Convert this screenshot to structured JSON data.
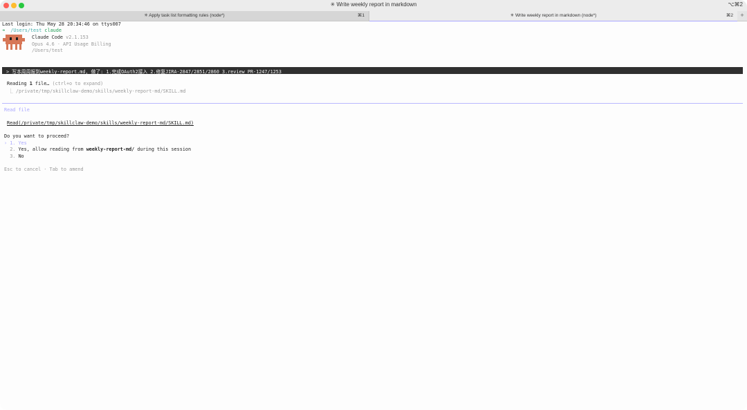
{
  "window": {
    "title": "✳ Write weekly report in markdown",
    "shortcut": "⌥⌘2"
  },
  "tabs": [
    {
      "label": "✳ Apply task list formatting rules (node*)",
      "key": "⌘1"
    },
    {
      "label": "✳ Write weekly report in markdown (node*)",
      "key": "⌘2"
    }
  ],
  "tab_add_label": "+",
  "terminal": {
    "last_login": "Last login: Thu May 28 20:34:46 on ttys007",
    "prompt_arrow": "➜",
    "prompt_path": "/Users/test",
    "prompt_cmd": "claude",
    "app_name": "Claude Code",
    "app_version": "v2.1.153",
    "model_info": "Opus 4.6 · API Usage Billing",
    "cwd": "/Users/test",
    "user_prompt": "> 写本周周报到weekly-report.md, 做了: 1.完成OAuth2接入 2.修复JIRA-2847/2851/2860 3.review PR-1247/1253",
    "reading_label": "Reading ",
    "reading_count": "1",
    "reading_suffix": " file…",
    "reading_hint": "(ctrl+o to expand)",
    "reading_path": "⎿ /private/tmp/skillclaw-demo/skills/weekly-report-md/SKILL.md",
    "section_title": "Read file",
    "read_call": "Read(/private/tmp/skillclaw-demo/skills/weekly-report-md/SKILL.md)",
    "question": "Do you want to proceed?",
    "options": [
      {
        "marker": "›",
        "number": "1.",
        "label": "Yes"
      },
      {
        "number": "2.",
        "prefix": "Yes, allow reading from ",
        "bold": "weekly-report-md/",
        "suffix": " during this session"
      },
      {
        "number": "3.",
        "label": "No"
      }
    ],
    "footer": "Esc to cancel · Tab to amend"
  },
  "colors": {
    "accent": "#a9a7ff",
    "mascot": "#d77757",
    "prompt_bg": "#303030"
  }
}
